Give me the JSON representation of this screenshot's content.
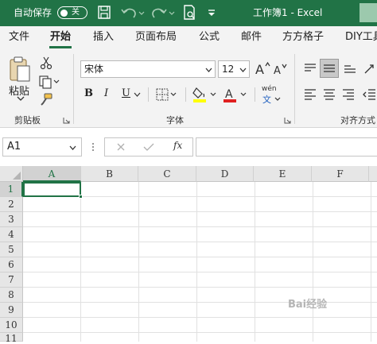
{
  "titlebar": {
    "autosave_label": "自动保存",
    "autosave_state": "关",
    "doc_title": "工作簿1  -  Excel",
    "accent": "#217346"
  },
  "tabs": [
    {
      "label": "文件"
    },
    {
      "label": "开始",
      "active": true
    },
    {
      "label": "插入"
    },
    {
      "label": "页面布局"
    },
    {
      "label": "公式"
    },
    {
      "label": "邮件"
    },
    {
      "label": "方方格子"
    },
    {
      "label": "DIY工具"
    }
  ],
  "ribbon": {
    "clipboard": {
      "paste_label": "粘贴",
      "group_label": "剪贴板"
    },
    "font": {
      "font_name": "宋体",
      "font_size": "12",
      "bold": "B",
      "italic": "I",
      "underline": "U",
      "phonetic": "wén",
      "group_label": "字体",
      "highlight_color": "#ffff00",
      "font_color": "#e02020"
    },
    "alignment": {
      "group_label": "对齐方式"
    }
  },
  "formula_bar": {
    "name_box": "A1",
    "fx": "fx",
    "value": ""
  },
  "grid": {
    "columns": [
      "A",
      "B",
      "C",
      "D",
      "E",
      "F"
    ],
    "rows": [
      "1",
      "2",
      "3",
      "4",
      "5",
      "6",
      "7",
      "8",
      "9",
      "10",
      "11"
    ],
    "active_cell": "A1"
  },
  "watermark": "Bai经验"
}
